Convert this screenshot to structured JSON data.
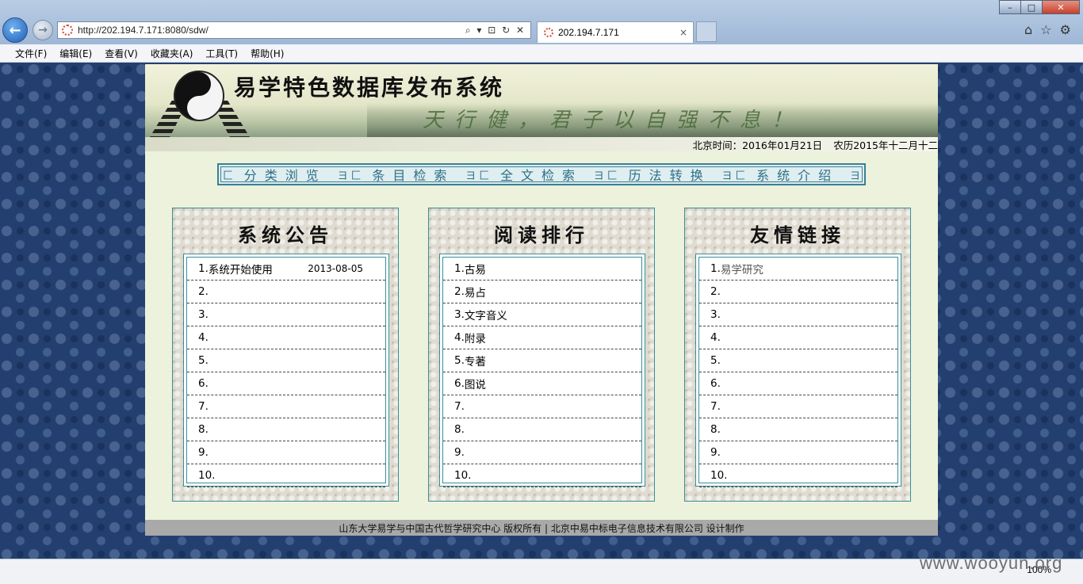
{
  "browser": {
    "url": "http://202.194.7.171:8080/sdw/",
    "tab_title": "202.194.7.171",
    "address_tools": "⌕ ▾ ⊡ ↻ ✕",
    "tab_close": "×",
    "window_min": "–",
    "window_max": "□",
    "window_close": "✕",
    "menu": [
      "文件(F)",
      "编辑(E)",
      "查看(V)",
      "收藏夹(A)",
      "工具(T)",
      "帮助(H)"
    ],
    "zoom": "100%"
  },
  "header": {
    "site_title": "易学特色数据库发布系统",
    "calligraphy": "天行健，君子以自强不息！",
    "time_label": "北京时间：2016年01月21日",
    "lunar_label": "农历2015年十二月十二"
  },
  "nav": [
    "分类浏览",
    "条目检索",
    "全文检索",
    "历法转换",
    "系统介绍"
  ],
  "panels": {
    "announcements": {
      "title": "系统公告",
      "rows": [
        {
          "num": "1.",
          "text": "系统开始使用",
          "date": "2013-08-05"
        },
        {
          "num": "2.",
          "text": "",
          "date": ""
        },
        {
          "num": "3.",
          "text": "",
          "date": ""
        },
        {
          "num": "4.",
          "text": "",
          "date": ""
        },
        {
          "num": "5.",
          "text": "",
          "date": ""
        },
        {
          "num": "6.",
          "text": "",
          "date": ""
        },
        {
          "num": "7.",
          "text": "",
          "date": ""
        },
        {
          "num": "8.",
          "text": "",
          "date": ""
        },
        {
          "num": "9.",
          "text": "",
          "date": ""
        },
        {
          "num": "10.",
          "text": "",
          "date": ""
        }
      ]
    },
    "ranking": {
      "title": "阅读排行",
      "rows": [
        {
          "num": "1.",
          "text": "古易"
        },
        {
          "num": "2.",
          "text": "易占"
        },
        {
          "num": "3.",
          "text": "文字音义"
        },
        {
          "num": "4.",
          "text": "附录"
        },
        {
          "num": "5.",
          "text": "专著"
        },
        {
          "num": "6.",
          "text": "图说"
        },
        {
          "num": "7.",
          "text": ""
        },
        {
          "num": "8.",
          "text": ""
        },
        {
          "num": "9.",
          "text": ""
        },
        {
          "num": "10.",
          "text": ""
        }
      ]
    },
    "links": {
      "title": "友情链接",
      "rows": [
        {
          "num": "1.",
          "text": "易学研究"
        },
        {
          "num": "2.",
          "text": ""
        },
        {
          "num": "3.",
          "text": ""
        },
        {
          "num": "4.",
          "text": ""
        },
        {
          "num": "5.",
          "text": ""
        },
        {
          "num": "6.",
          "text": ""
        },
        {
          "num": "7.",
          "text": ""
        },
        {
          "num": "8.",
          "text": ""
        },
        {
          "num": "9.",
          "text": ""
        },
        {
          "num": "10.",
          "text": ""
        }
      ]
    }
  },
  "footer": "山东大学易学与中国古代哲学研究中心  版权所有  |  北京中易中标电子信息技术有限公司  设计制作",
  "watermark": "www.wooyun.org",
  "colors": {
    "page_bg": "#ecf2dc",
    "frame": "#3a8f9a",
    "nav_text": "#2e6f86",
    "outer_bg": "#233f70"
  }
}
